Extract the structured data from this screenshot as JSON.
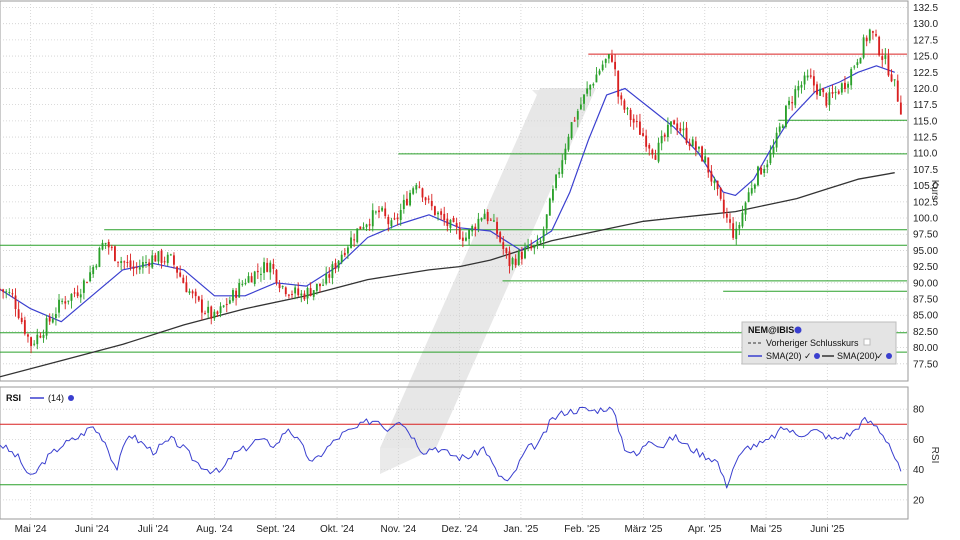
{
  "chart_data": [
    {
      "type": "candlestick",
      "symbol": "NEM@IBIS",
      "ylabel": "Kurs",
      "ylim": [
        75.0,
        133.5
      ],
      "y_ticks": [
        "132.5",
        "130.0",
        "127.5",
        "125.0",
        "122.5",
        "120.0",
        "117.5",
        "115.0",
        "112.5",
        "110.0",
        "107.5",
        "105.0",
        "102.5",
        "100.0",
        "97.50",
        "95.00",
        "92.50",
        "90.00",
        "87.50",
        "85.00",
        "82.50",
        "80.00",
        "77.50"
      ],
      "x_labels": [
        "Mai '24",
        "Juni '24",
        "Juli '24",
        "Aug. '24",
        "Sept. '24",
        "Okt. '24",
        "Nov. '24",
        "Dez. '24",
        "Jan. '25",
        "Feb. '25",
        "März '25",
        "Apr. '25",
        "Mai '25",
        "Juni '25"
      ],
      "x_label_months": [
        0.5,
        1.5,
        2.5,
        3.5,
        4.5,
        5.5,
        6.5,
        7.5,
        8.5,
        9.5,
        10.5,
        11.5,
        12.5,
        13.5
      ],
      "x_range_months": [
        0,
        14.8
      ],
      "price_path": [
        [
          0,
          89
        ],
        [
          0.2,
          88
        ],
        [
          0.5,
          80.5
        ],
        [
          0.8,
          84
        ],
        [
          1.0,
          87
        ],
        [
          1.3,
          89
        ],
        [
          1.5,
          92
        ],
        [
          1.7,
          96.5
        ],
        [
          1.9,
          94
        ],
        [
          2.2,
          92
        ],
        [
          2.5,
          94
        ],
        [
          2.8,
          93.5
        ],
        [
          3.0,
          90
        ],
        [
          3.2,
          87
        ],
        [
          3.5,
          84.5
        ],
        [
          3.8,
          88
        ],
        [
          4.0,
          90.5
        ],
        [
          4.4,
          93
        ],
        [
          4.6,
          89.5
        ],
        [
          4.9,
          88
        ],
        [
          5.3,
          90
        ],
        [
          5.6,
          95
        ],
        [
          5.9,
          99
        ],
        [
          6.2,
          101
        ],
        [
          6.4,
          98.5
        ],
        [
          6.8,
          106
        ],
        [
          7.0,
          102
        ],
        [
          7.3,
          99
        ],
        [
          7.6,
          97
        ],
        [
          7.9,
          101
        ],
        [
          8.1,
          98
        ],
        [
          8.3,
          93
        ],
        [
          8.6,
          95
        ],
        [
          8.8,
          95.5
        ],
        [
          9.0,
          103
        ],
        [
          9.3,
          114
        ],
        [
          9.6,
          120
        ],
        [
          9.85,
          124
        ],
        [
          10.0,
          125
        ],
        [
          10.1,
          118
        ],
        [
          10.4,
          114
        ],
        [
          10.7,
          110
        ],
        [
          11.0,
          115
        ],
        [
          11.2,
          112.5
        ],
        [
          11.5,
          109
        ],
        [
          11.8,
          101
        ],
        [
          12.0,
          97
        ],
        [
          12.15,
          102
        ],
        [
          12.3,
          106
        ],
        [
          12.6,
          110
        ],
        [
          12.8,
          116
        ],
        [
          13.0,
          120
        ],
        [
          13.2,
          121.5
        ],
        [
          13.5,
          118
        ],
        [
          13.8,
          121
        ],
        [
          14.0,
          125
        ],
        [
          14.2,
          129
        ],
        [
          14.35,
          126
        ],
        [
          14.55,
          122
        ],
        [
          14.7,
          117
        ]
      ],
      "sma20_path": [
        [
          0,
          89
        ],
        [
          0.5,
          86
        ],
        [
          1.0,
          84
        ],
        [
          1.5,
          88
        ],
        [
          2.0,
          92
        ],
        [
          2.5,
          93
        ],
        [
          3.0,
          92
        ],
        [
          3.5,
          88
        ],
        [
          4.0,
          88
        ],
        [
          4.5,
          90
        ],
        [
          5.0,
          89.5
        ],
        [
          5.5,
          92.5
        ],
        [
          6.0,
          97
        ],
        [
          6.5,
          99
        ],
        [
          7.0,
          100.5
        ],
        [
          7.5,
          98.5
        ],
        [
          8.0,
          98
        ],
        [
          8.5,
          95
        ],
        [
          9.0,
          98
        ],
        [
          9.3,
          104
        ],
        [
          9.6,
          112
        ],
        [
          9.9,
          119
        ],
        [
          10.2,
          120
        ],
        [
          10.6,
          117
        ],
        [
          11.0,
          114
        ],
        [
          11.4,
          110
        ],
        [
          11.8,
          104
        ],
        [
          12.0,
          103.5
        ],
        [
          12.3,
          106
        ],
        [
          12.6,
          111
        ],
        [
          12.9,
          115.5
        ],
        [
          13.3,
          119.5
        ],
        [
          13.7,
          121
        ],
        [
          14.0,
          122.5
        ],
        [
          14.3,
          123.5
        ],
        [
          14.6,
          122.5
        ]
      ],
      "sma200_path": [
        [
          0,
          75.5
        ],
        [
          1.0,
          78
        ],
        [
          2.0,
          80.5
        ],
        [
          3.0,
          83.5
        ],
        [
          4.0,
          86
        ],
        [
          5.0,
          88
        ],
        [
          6.0,
          90.5
        ],
        [
          7.0,
          92
        ],
        [
          7.5,
          92.5
        ],
        [
          8.0,
          93.5
        ],
        [
          8.5,
          95
        ],
        [
          9.0,
          96.5
        ],
        [
          9.5,
          97.5
        ],
        [
          10.0,
          98.5
        ],
        [
          10.5,
          99.5
        ],
        [
          11.0,
          100
        ],
        [
          11.5,
          100.5
        ],
        [
          12.0,
          101
        ],
        [
          12.5,
          102
        ],
        [
          13.0,
          103
        ],
        [
          13.5,
          104.5
        ],
        [
          14.0,
          106
        ],
        [
          14.6,
          107
        ]
      ],
      "horizontal_lines": [
        {
          "y": 125.3,
          "color": "#d92020",
          "x_from": 9.6,
          "x_to": 14.8
        },
        {
          "y": 115.1,
          "color": "#2aa02a",
          "x_from": 12.7,
          "x_to": 14.8
        },
        {
          "y": 109.9,
          "color": "#2aa02a",
          "x_from": 6.5,
          "x_to": 14.8
        },
        {
          "y": 98.2,
          "color": "#2aa02a",
          "x_from": 1.7,
          "x_to": 14.8
        },
        {
          "y": 95.8,
          "color": "#2aa02a",
          "x_from": 0,
          "x_to": 14.8
        },
        {
          "y": 90.3,
          "color": "#2aa02a",
          "x_from": 8.2,
          "x_to": 14.8
        },
        {
          "y": 88.7,
          "color": "#2aa02a",
          "x_from": 11.8,
          "x_to": 14.8
        },
        {
          "y": 82.3,
          "color": "#2aa02a",
          "x_from": 0,
          "x_to": 14.8
        },
        {
          "y": 79.3,
          "color": "#2aa02a",
          "x_from": 0,
          "x_to": 14.8
        }
      ],
      "legend": {
        "title": "NEM@IBIS",
        "items": [
          "Vorheriger Schlusskurs",
          "SMA(20)",
          "SMA(200)"
        ],
        "placement": "bottom-right"
      },
      "colors": {
        "up": "#2aa02a",
        "down": "#d92020",
        "sma20": "#3a3fcf",
        "sma200": "#333333"
      }
    },
    {
      "type": "line",
      "title": "RSI",
      "param_label": "(14)",
      "ylabel": "RSI",
      "ylim": [
        8,
        94
      ],
      "y_ticks": [
        "80",
        "60",
        "40",
        "20"
      ],
      "overbought": 70,
      "oversold": 30,
      "series": [
        {
          "name": "(14)",
          "color": "#3a3fcf",
          "path": [
            [
              0,
              57
            ],
            [
              0.3,
              48
            ],
            [
              0.5,
              34
            ],
            [
              0.75,
              47
            ],
            [
              1.0,
              56
            ],
            [
              1.3,
              62
            ],
            [
              1.5,
              69
            ],
            [
              1.7,
              60
            ],
            [
              1.9,
              40
            ],
            [
              2.1,
              64
            ],
            [
              2.3,
              58
            ],
            [
              2.5,
              52
            ],
            [
              2.8,
              60
            ],
            [
              3.0,
              54
            ],
            [
              3.2,
              45
            ],
            [
              3.4,
              40
            ],
            [
              3.6,
              38
            ],
            [
              3.8,
              50
            ],
            [
              4.0,
              54
            ],
            [
              4.2,
              60
            ],
            [
              4.5,
              56
            ],
            [
              4.7,
              68
            ],
            [
              4.9,
              57
            ],
            [
              5.1,
              44
            ],
            [
              5.3,
              53
            ],
            [
              5.6,
              64
            ],
            [
              5.8,
              67
            ],
            [
              6.0,
              72
            ],
            [
              6.2,
              73
            ],
            [
              6.3,
              66
            ],
            [
              6.5,
              74
            ],
            [
              6.7,
              64
            ],
            [
              6.9,
              52
            ],
            [
              7.1,
              55
            ],
            [
              7.3,
              51
            ],
            [
              7.5,
              48
            ],
            [
              7.7,
              49
            ],
            [
              7.9,
              55
            ],
            [
              8.1,
              38
            ],
            [
              8.3,
              31
            ],
            [
              8.6,
              54
            ],
            [
              8.8,
              57
            ],
            [
              9.0,
              73
            ],
            [
              9.2,
              78
            ],
            [
              9.5,
              80
            ],
            [
              9.7,
              79
            ],
            [
              9.9,
              81
            ],
            [
              10.0,
              79
            ],
            [
              10.2,
              54
            ],
            [
              10.4,
              49
            ],
            [
              10.6,
              61
            ],
            [
              10.8,
              55
            ],
            [
              11.0,
              62
            ],
            [
              11.2,
              56
            ],
            [
              11.4,
              51
            ],
            [
              11.7,
              46
            ],
            [
              11.85,
              29
            ],
            [
              12.0,
              45
            ],
            [
              12.2,
              55
            ],
            [
              12.5,
              58
            ],
            [
              12.8,
              68
            ],
            [
              13.0,
              63
            ],
            [
              13.3,
              66
            ],
            [
              13.6,
              60
            ],
            [
              13.9,
              64
            ],
            [
              14.1,
              73
            ],
            [
              14.3,
              69
            ],
            [
              14.5,
              58
            ],
            [
              14.7,
              38
            ]
          ]
        }
      ]
    }
  ]
}
